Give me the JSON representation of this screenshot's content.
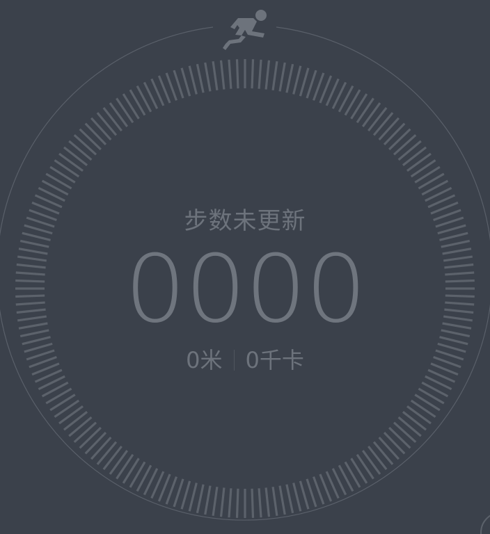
{
  "status": {
    "text": "步数未更新"
  },
  "steps": {
    "value": "0000"
  },
  "stats": {
    "distance": "0米",
    "calories": "0千卡"
  },
  "icons": {
    "top": "running-man-icon"
  },
  "colors": {
    "background": "#3b414b",
    "ticks": "#5c626b",
    "outer_ring": "#5a606a",
    "text": "#6d737c"
  }
}
